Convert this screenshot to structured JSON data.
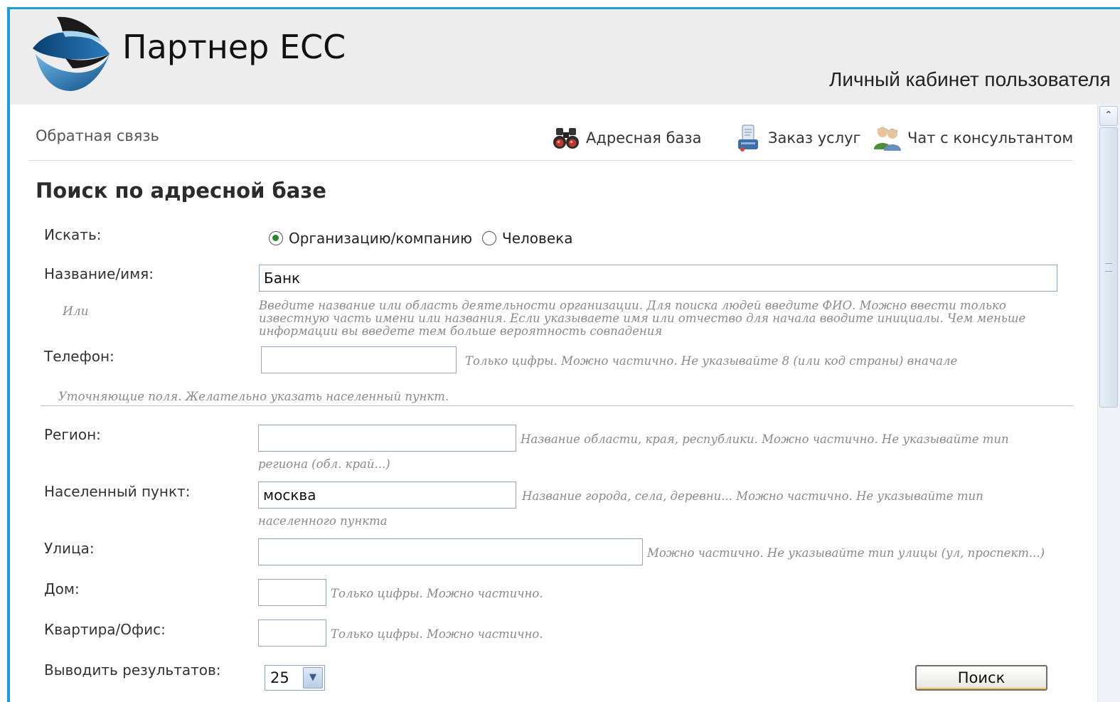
{
  "header": {
    "app_title": "Партнер ЕСС",
    "cabinet_label": "Личный кабинет пользователя"
  },
  "nav": {
    "feedback": "Обратная связь",
    "items": [
      {
        "label": "Адресная база",
        "icon": "binoculars-icon"
      },
      {
        "label": "Заказ услуг",
        "icon": "services-order-icon"
      },
      {
        "label": "Чат с консультантом",
        "icon": "chat-consultant-icon"
      }
    ]
  },
  "page": {
    "title": "Поиск по адресной базе"
  },
  "form": {
    "search_label": "Искать:",
    "search_options": [
      "Организацию/компанию",
      "Человека"
    ],
    "search_selected": "Организацию/компанию",
    "name_label": "Название/имя:",
    "name_value": "Банк",
    "or_label": "Или",
    "name_hint": "Введите название или область деятельности организации. Для поиска людей введите ФИО. Можно ввести только известную часть имени или названия. Если указываете имя или отчество для начала вводите инициалы. Чем меньше информации вы введете тем больше вероятность совпадения",
    "phone_label": "Телефон:",
    "phone_value": "",
    "phone_hint": "Только цифры. Можно частично. Не указывайте 8 (или код страны) вначале",
    "refine_hint": "Уточняющие поля. Желательно указать населенный пункт.",
    "region_label": "Регион:",
    "region_value": "",
    "region_hint_1": "Название области, края, республики. Можно частично. Не указывайте тип",
    "region_hint_2": "региона (обл. край...)",
    "city_label": "Населенный пункт:",
    "city_value": "москва",
    "city_hint_1": "Название города, села, деревни... Можно частично. Не указывайте тип",
    "city_hint_2": "населенного пункта",
    "street_label": "Улица:",
    "street_value": "",
    "street_hint": "Можно частично. Не указывайте тип улицы (ул, проспект...)",
    "house_label": "Дом:",
    "house_value": "",
    "house_hint": "Только цифры. Можно частично.",
    "apt_label": "Квартира/Офис:",
    "apt_value": "",
    "apt_hint": "Только цифры. Можно частично.",
    "results_label": "Выводить результатов:",
    "results_value": "25",
    "search_button": "Поиск"
  },
  "colors": {
    "frame_blue": "#1a9ed8",
    "header_bg": "#ededed",
    "input_border": "#8ea6c4",
    "radio_selected": "#2a8a2a"
  }
}
